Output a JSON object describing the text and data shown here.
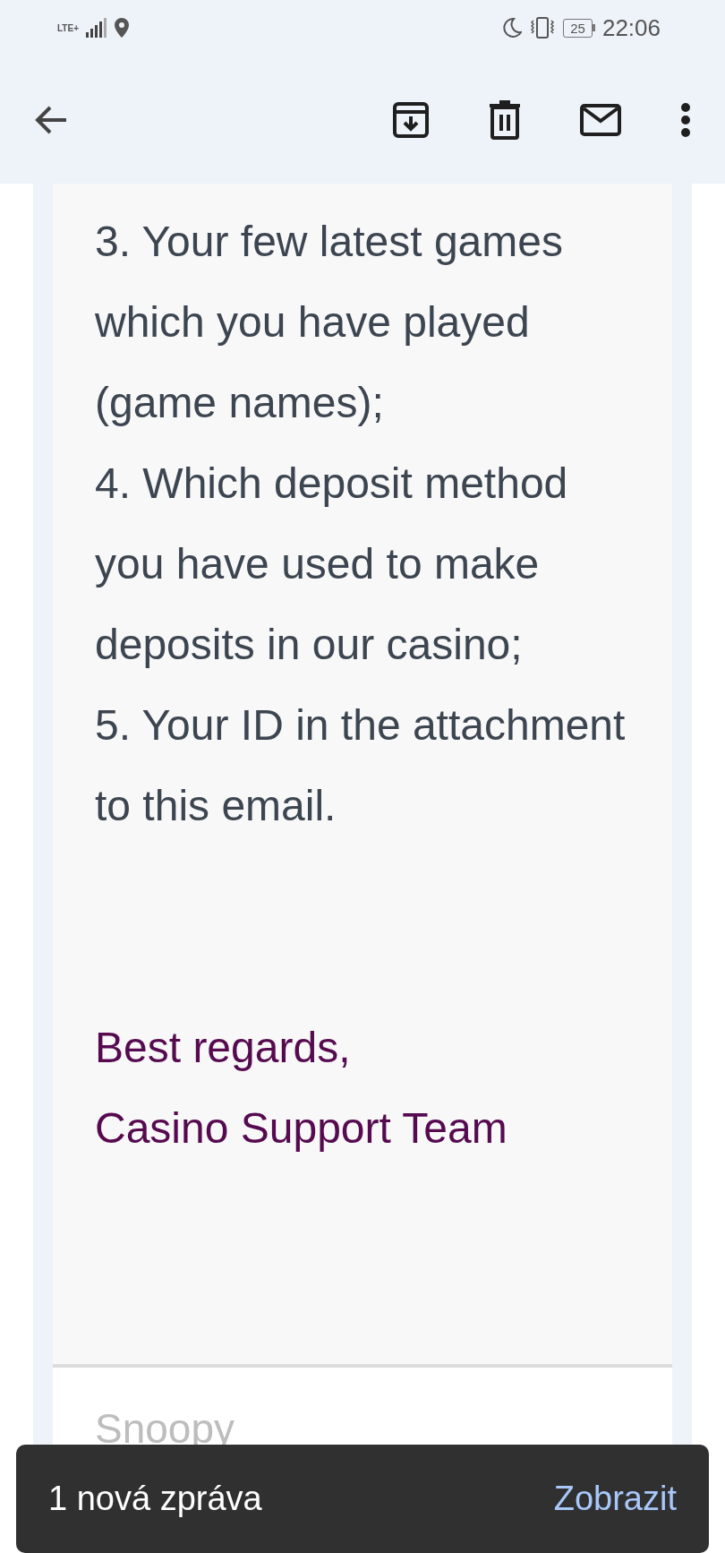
{
  "status_bar": {
    "network": "LTE+",
    "battery": "25",
    "time": "22:06"
  },
  "body": {
    "items": [
      "3. Your few latest games which you have played (game names);",
      "4. Which deposit method you have used to make deposits in our casino;",
      "5. Your ID in the attachment to this email."
    ],
    "signature": [
      "Best regards,",
      "Casino Support Team"
    ]
  },
  "next_message": {
    "sender": "Snoopy"
  },
  "snackbar": {
    "message": "1 nová zpráva",
    "action": "Zobrazit"
  }
}
